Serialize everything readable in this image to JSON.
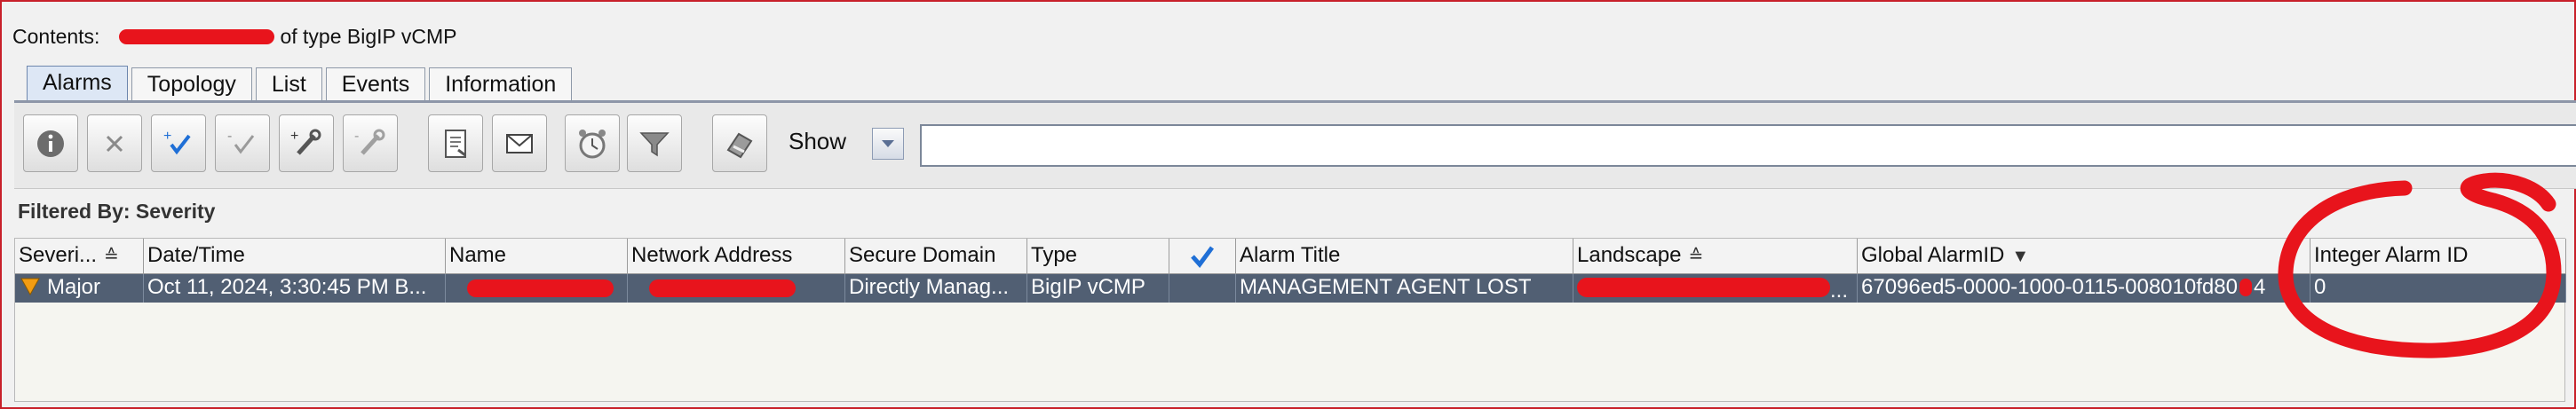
{
  "header": {
    "contents_prefix": "Contents:",
    "contents_suffix": "of type BigIP vCMP"
  },
  "tabs": [
    {
      "label": "Alarms",
      "active": true
    },
    {
      "label": "Topology",
      "active": false
    },
    {
      "label": "List",
      "active": false
    },
    {
      "label": "Events",
      "active": false
    },
    {
      "label": "Information",
      "active": false
    }
  ],
  "toolbar": {
    "icons": [
      "info-icon",
      "clear-icon",
      "acknowledge-add-icon",
      "acknowledge-remove-icon",
      "assign-trouble-add-icon",
      "assign-trouble-remove-icon",
      "report-icon",
      "email-icon",
      "alarm-clock-icon",
      "filter-icon",
      "tools-icon"
    ],
    "show_label": "Show",
    "search_value": ""
  },
  "filter": {
    "label": "Filtered By: Severity"
  },
  "table": {
    "columns": [
      "Severi...",
      "Date/Time",
      "Name",
      "Network Address",
      "Secure Domain",
      "Type",
      "",
      "Alarm Title",
      "Landscape",
      "Global AlarmID",
      "Integer Alarm ID"
    ],
    "rows": [
      {
        "severity": "Major",
        "datetime": "Oct 11, 2024, 3:30:45 PM B...",
        "name": "",
        "network_address": "",
        "secure_domain": "Directly Manag...",
        "type": "BigIP vCMP",
        "acknowledged": "",
        "alarm_title": "MANAGEMENT AGENT LOST",
        "landscape_suffix": "...",
        "global_alarm_id": "67096ed5-0000-1000-0115-008010fd80",
        "global_alarm_id_tail": "4",
        "integer_alarm_id": "0"
      }
    ]
  },
  "colors": {
    "selected_row": "#515f73",
    "severity_major": "#f39c12",
    "annotation": "#e8141c",
    "check": "#1f6fd6"
  }
}
